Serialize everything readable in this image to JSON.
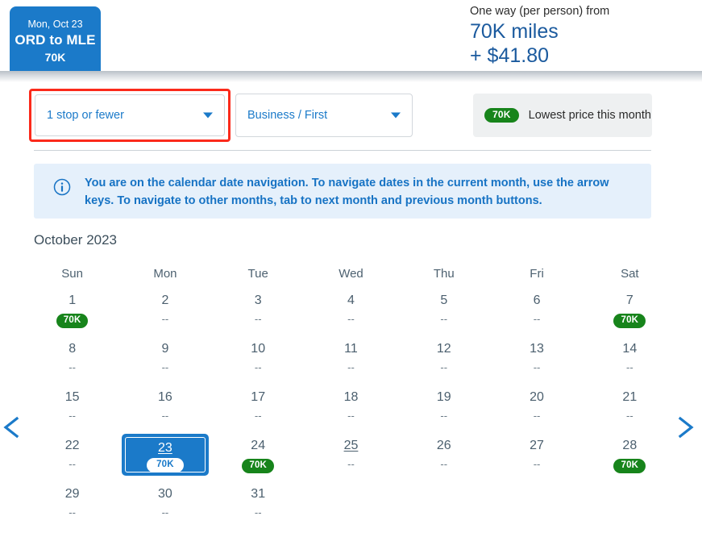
{
  "header": {
    "flight_tab": {
      "date": "Mon, Oct 23",
      "route": "ORD to MLE",
      "miles": "70K"
    },
    "price": {
      "label": "One way (per person) from",
      "miles": "70K miles",
      "cash": "+ $41.80"
    }
  },
  "filters": {
    "stops": {
      "value": "1 stop or fewer",
      "caret_icon": "chevron-down-icon"
    },
    "cabin": {
      "value": "Business / First",
      "caret_icon": "chevron-down-icon"
    },
    "legend": {
      "badge": "70K",
      "text": "Lowest price this month"
    }
  },
  "banner": {
    "icon": "info-circle-icon",
    "text": "You are on the calendar date navigation. To navigate dates in the current month, use the arrow keys. To navigate to other months, tab to next month and previous month buttons."
  },
  "calendar": {
    "month_title": "October 2023",
    "weekdays": [
      "Sun",
      "Mon",
      "Tue",
      "Wed",
      "Thu",
      "Fri",
      "Sat"
    ],
    "empty_value": "--",
    "prev_icon": "chevron-left-icon",
    "next_icon": "chevron-right-icon",
    "weeks": [
      [
        {
          "day": "1",
          "value": "70K",
          "has_price": true,
          "selected": false,
          "today": false
        },
        {
          "day": "2",
          "value": "--",
          "has_price": false,
          "selected": false,
          "today": false
        },
        {
          "day": "3",
          "value": "--",
          "has_price": false,
          "selected": false,
          "today": false
        },
        {
          "day": "4",
          "value": "--",
          "has_price": false,
          "selected": false,
          "today": false
        },
        {
          "day": "5",
          "value": "--",
          "has_price": false,
          "selected": false,
          "today": false
        },
        {
          "day": "6",
          "value": "--",
          "has_price": false,
          "selected": false,
          "today": false
        },
        {
          "day": "7",
          "value": "70K",
          "has_price": true,
          "selected": false,
          "today": false
        }
      ],
      [
        {
          "day": "8",
          "value": "--",
          "has_price": false,
          "selected": false,
          "today": false
        },
        {
          "day": "9",
          "value": "--",
          "has_price": false,
          "selected": false,
          "today": false
        },
        {
          "day": "10",
          "value": "--",
          "has_price": false,
          "selected": false,
          "today": false
        },
        {
          "day": "11",
          "value": "--",
          "has_price": false,
          "selected": false,
          "today": false
        },
        {
          "day": "12",
          "value": "--",
          "has_price": false,
          "selected": false,
          "today": false
        },
        {
          "day": "13",
          "value": "--",
          "has_price": false,
          "selected": false,
          "today": false
        },
        {
          "day": "14",
          "value": "--",
          "has_price": false,
          "selected": false,
          "today": false
        }
      ],
      [
        {
          "day": "15",
          "value": "--",
          "has_price": false,
          "selected": false,
          "today": false
        },
        {
          "day": "16",
          "value": "--",
          "has_price": false,
          "selected": false,
          "today": false
        },
        {
          "day": "17",
          "value": "--",
          "has_price": false,
          "selected": false,
          "today": false
        },
        {
          "day": "18",
          "value": "--",
          "has_price": false,
          "selected": false,
          "today": false
        },
        {
          "day": "19",
          "value": "--",
          "has_price": false,
          "selected": false,
          "today": false
        },
        {
          "day": "20",
          "value": "--",
          "has_price": false,
          "selected": false,
          "today": false
        },
        {
          "day": "21",
          "value": "--",
          "has_price": false,
          "selected": false,
          "today": false
        }
      ],
      [
        {
          "day": "22",
          "value": "--",
          "has_price": false,
          "selected": false,
          "today": false
        },
        {
          "day": "23",
          "value": "70K",
          "has_price": true,
          "selected": true,
          "today": true
        },
        {
          "day": "24",
          "value": "70K",
          "has_price": true,
          "selected": false,
          "today": false
        },
        {
          "day": "25",
          "value": "--",
          "has_price": false,
          "selected": false,
          "today": true
        },
        {
          "day": "26",
          "value": "--",
          "has_price": false,
          "selected": false,
          "today": false
        },
        {
          "day": "27",
          "value": "--",
          "has_price": false,
          "selected": false,
          "today": false
        },
        {
          "day": "28",
          "value": "70K",
          "has_price": true,
          "selected": false,
          "today": false
        }
      ],
      [
        {
          "day": "29",
          "value": "--",
          "has_price": false,
          "selected": false,
          "today": false
        },
        {
          "day": "30",
          "value": "--",
          "has_price": false,
          "selected": false,
          "today": false
        },
        {
          "day": "31",
          "value": "--",
          "has_price": false,
          "selected": false,
          "today": false
        },
        {
          "day": "",
          "value": "",
          "has_price": false,
          "selected": false,
          "today": false
        },
        {
          "day": "",
          "value": "",
          "has_price": false,
          "selected": false,
          "today": false
        },
        {
          "day": "",
          "value": "",
          "has_price": false,
          "selected": false,
          "today": false
        },
        {
          "day": "",
          "value": "",
          "has_price": false,
          "selected": false,
          "today": false
        }
      ]
    ]
  },
  "colors": {
    "brand_blue": "#1b7ac9",
    "dark_blue": "#1b5a9e",
    "price_green": "#17841b",
    "focus_red": "#fb2a1b",
    "banner_bg": "#e5f0fb",
    "banner_text": "#1773c4"
  }
}
